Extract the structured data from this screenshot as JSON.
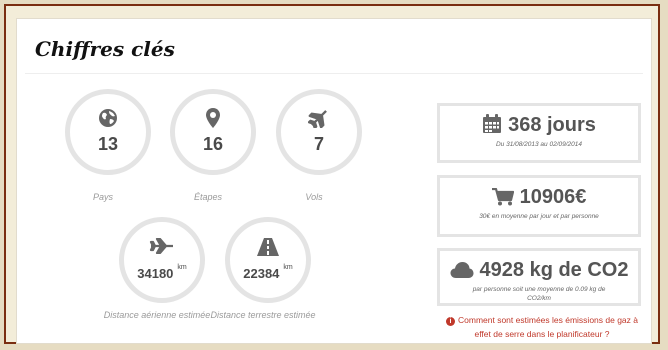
{
  "title": "Chiffres clés",
  "stats": {
    "countries": {
      "value": "13",
      "label": "Pays",
      "icon": "globe-icon"
    },
    "stages": {
      "value": "16",
      "label": "Étapes",
      "icon": "map-marker-icon"
    },
    "flights": {
      "value": "7",
      "label": "Vols",
      "icon": "plane-icon"
    },
    "air_distance": {
      "value": "34180",
      "unit": "km",
      "label": "Distance aérienne estimée",
      "icon": "plane-icon"
    },
    "land_distance": {
      "value": "22384",
      "unit": "km",
      "label": "Distance terrestre estimée",
      "icon": "road-icon"
    }
  },
  "summary": {
    "duration": {
      "value": "368 jours",
      "sub": "Du 31/08/2013 au 02/09/2014",
      "icon": "calendar-icon"
    },
    "budget": {
      "value": "10906€",
      "sub": "30€ en moyenne par jour et par personne",
      "icon": "cart-icon"
    },
    "co2": {
      "value": "4928 kg de CO2",
      "sub": "par personne soit une moyenne de 0.09 kg de CO2/km",
      "icon": "cloud-icon"
    }
  },
  "note": "Comment sont estimées les émissions de gaz à effet de serre dans le planificateur ?",
  "colors": {
    "accent_red": "#c0392b",
    "frame": "#7a2d10",
    "icon_grey": "#666666"
  }
}
